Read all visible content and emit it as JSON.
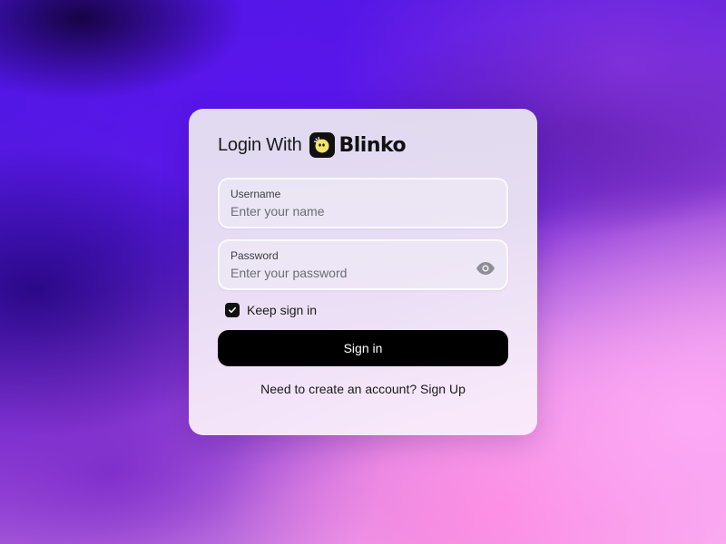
{
  "login": {
    "title_prefix": "Login With",
    "brand_name": "Blinko",
    "username": {
      "label": "Username",
      "placeholder": "Enter your name",
      "value": ""
    },
    "password": {
      "label": "Password",
      "placeholder": "Enter your password",
      "value": ""
    },
    "keep_signin": {
      "label": "Keep sign in",
      "checked": true
    },
    "signin_button_label": "Sign in",
    "signup_prompt": "Need to create an account?",
    "signup_link_label": "Sign Up"
  },
  "colors": {
    "button_bg": "#000000",
    "button_text": "#ffffff",
    "logo_face": "#f7e36b"
  },
  "icons": {
    "logo": "blinko-logo-icon",
    "eye": "eye-icon",
    "check": "check-icon"
  }
}
